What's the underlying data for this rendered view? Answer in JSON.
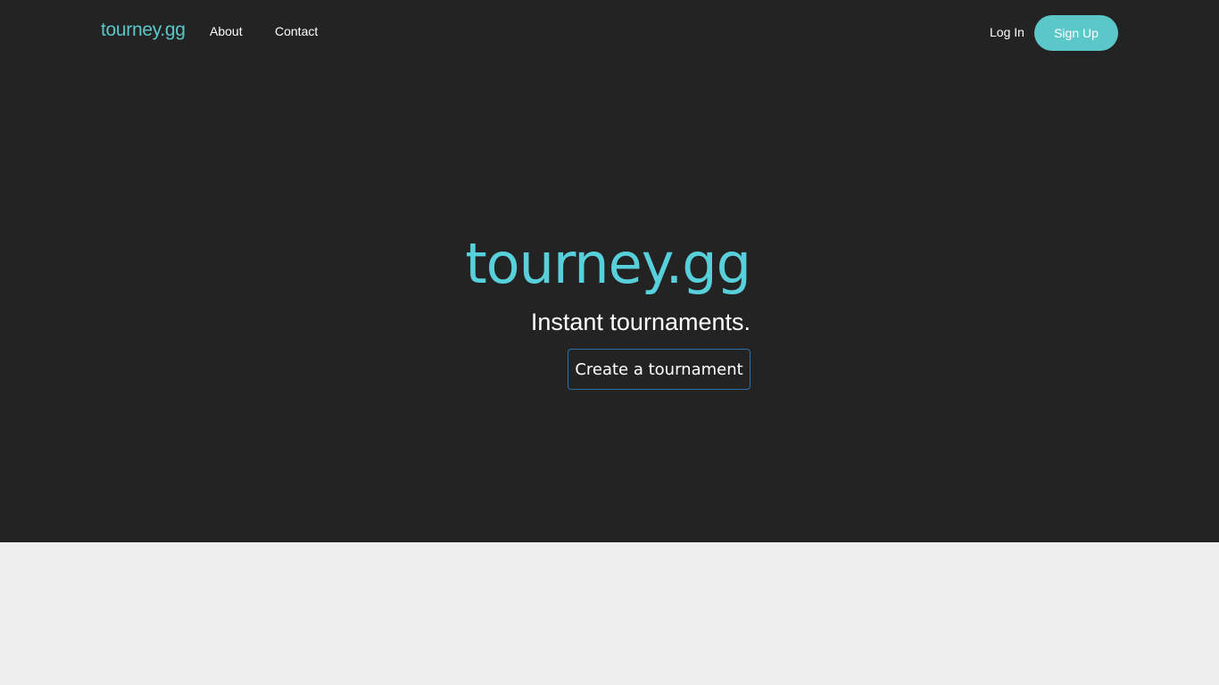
{
  "navbar": {
    "brand": "tourney.gg",
    "links": [
      "About",
      "Contact"
    ],
    "login_label": "Log In",
    "signup_label": "Sign Up"
  },
  "hero": {
    "title": "tourney.gg",
    "subtitle": "Instant tournaments.",
    "cta_label": "Create a tournament"
  },
  "colors": {
    "background_dark": "#232323",
    "background_light": "#eeeeee",
    "accent": "#5bc7c9",
    "cta_border": "#2f6fa5"
  }
}
